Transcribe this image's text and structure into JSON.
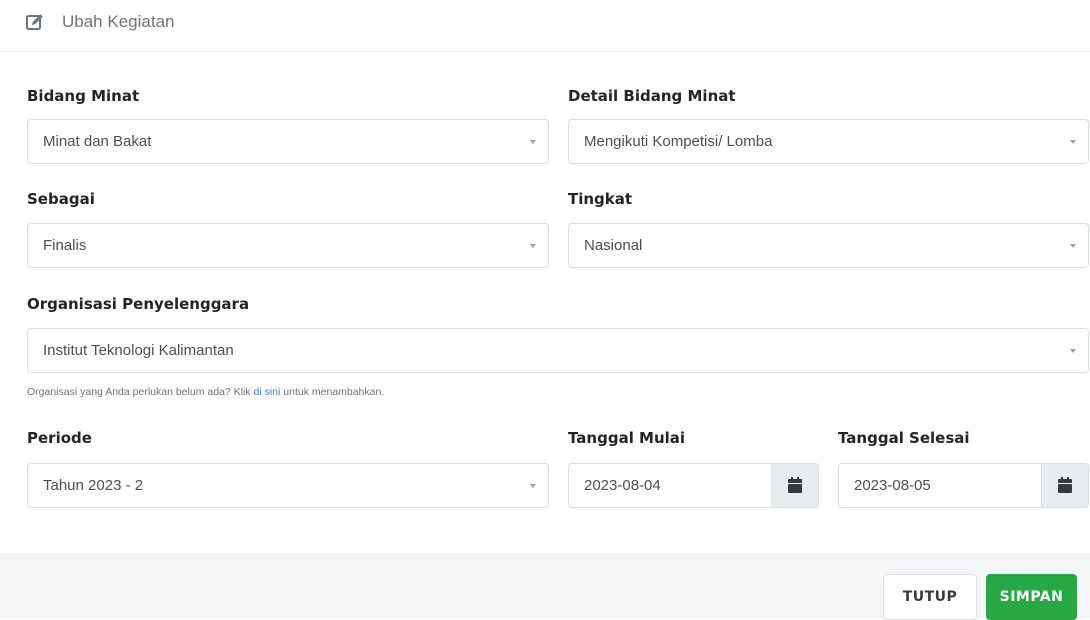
{
  "modal": {
    "title": "Ubah Kegiatan",
    "title_icon": "edit-icon"
  },
  "form": {
    "bidang_minat": {
      "label": "Bidang Minat",
      "value": "Minat dan Bakat"
    },
    "detail_bidang_minat": {
      "label": "Detail Bidang Minat",
      "value": "Mengikuti Kompetisi/ Lomba"
    },
    "sebagai": {
      "label": "Sebagai",
      "value": "Finalis"
    },
    "tingkat": {
      "label": "Tingkat",
      "value": "Nasional"
    },
    "organisasi": {
      "label": "Organisasi Penyelenggara",
      "value": "Institut Teknologi Kalimantan",
      "help_prefix": "Organisasi yang Anda perlukan belum ada? Klik ",
      "help_link": "di sini",
      "help_suffix": " untuk menambahkan."
    },
    "periode": {
      "label": "Periode",
      "value": "Tahun 2023 - 2"
    },
    "tanggal_mulai": {
      "label": "Tanggal Mulai",
      "value": "2023-08-04",
      "icon": "calendar-icon"
    },
    "tanggal_selesai": {
      "label": "Tanggal Selesai",
      "value": "2023-08-05",
      "icon": "calendar-icon"
    }
  },
  "footer": {
    "close_label": "TUTUP",
    "save_label": "SIMPAN"
  },
  "colors": {
    "save_button": "#28a745",
    "link": "#3b7ddd",
    "footer_bg": "#f4f5f7"
  }
}
